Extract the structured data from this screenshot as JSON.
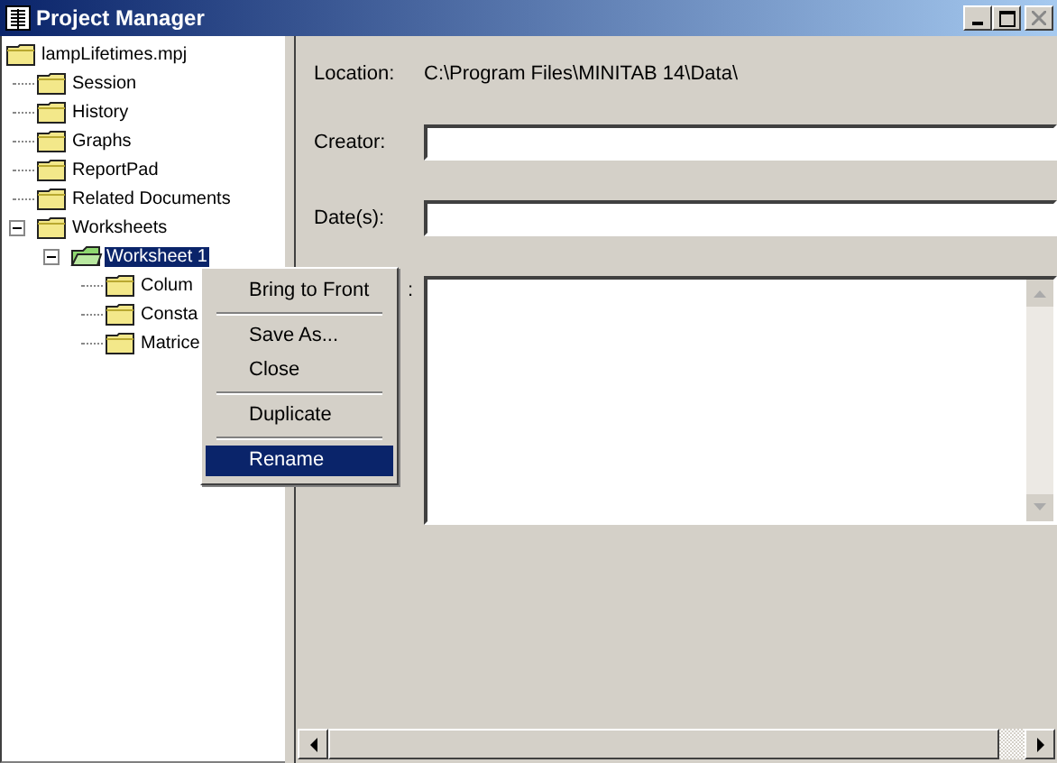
{
  "window": {
    "title": "Project Manager"
  },
  "tree": [
    {
      "label": "lampLifetimes.mpj",
      "selected": false,
      "children": [
        {
          "label": "Session",
          "selected": false
        },
        {
          "label": "History",
          "selected": false
        },
        {
          "label": "Graphs",
          "selected": false
        },
        {
          "label": "ReportPad",
          "selected": false
        },
        {
          "label": "Related Documents",
          "selected": false
        },
        {
          "label": "Worksheets",
          "selected": false,
          "expanded": true,
          "children": [
            {
              "label": "Worksheet 1",
              "selected": true,
              "expanded": true,
              "kind": "worksheet",
              "children": [
                {
                  "label": "Colum",
                  "selected": false
                },
                {
                  "label": "Consta",
                  "selected": false
                },
                {
                  "label": "Matrice",
                  "selected": false
                }
              ]
            }
          ]
        }
      ]
    }
  ],
  "details": {
    "location_label": "Location:",
    "location": "C:\\Program Files\\MINITAB 14\\Data\\",
    "fields": [
      {
        "label": "Creator:",
        "kind": "line"
      },
      {
        "label": "Date(s):",
        "kind": "line"
      },
      {
        "label": ":",
        "kind": "multiline"
      }
    ]
  },
  "context_menu": [
    {
      "kind": "item",
      "label": "Bring to Front",
      "selected": false
    },
    {
      "kind": "separator"
    },
    {
      "kind": "item",
      "label": "Save As...",
      "selected": false
    },
    {
      "kind": "item",
      "label": "Close",
      "selected": false
    },
    {
      "kind": "separator"
    },
    {
      "kind": "item",
      "label": "Duplicate",
      "selected": false
    },
    {
      "kind": "separator"
    },
    {
      "kind": "item",
      "label": "Rename",
      "selected": true
    }
  ]
}
